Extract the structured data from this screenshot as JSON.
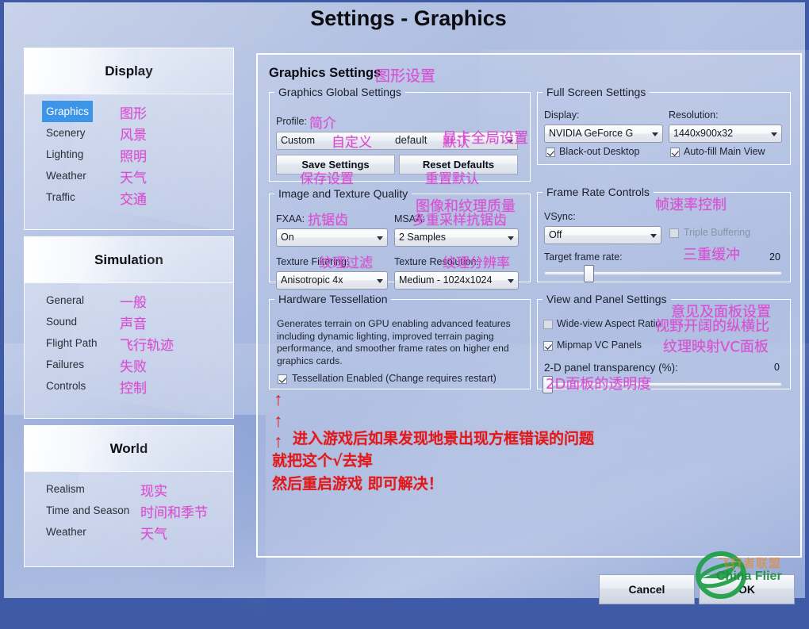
{
  "window": {
    "title": "Settings - Graphics"
  },
  "sidebar": {
    "groups": [
      {
        "header": "Display",
        "items": [
          {
            "label": "Graphics",
            "cn": "图形",
            "selected": true
          },
          {
            "label": "Scenery",
            "cn": "风景",
            "selected": false
          },
          {
            "label": "Lighting",
            "cn": "照明",
            "selected": false
          },
          {
            "label": "Weather",
            "cn": "天气",
            "selected": false
          },
          {
            "label": "Traffic",
            "cn": "交通",
            "selected": false
          }
        ]
      },
      {
        "header": "Simulation",
        "items": [
          {
            "label": "General",
            "cn": "一般",
            "selected": false
          },
          {
            "label": "Sound",
            "cn": "声音",
            "selected": false
          },
          {
            "label": "Flight Path",
            "cn": "飞行轨迹",
            "selected": false
          },
          {
            "label": "Failures",
            "cn": "失败",
            "selected": false
          },
          {
            "label": "Controls",
            "cn": "控制",
            "selected": false
          }
        ]
      },
      {
        "header": "World",
        "items": [
          {
            "label": "Realism",
            "cn": "现实",
            "selected": false
          },
          {
            "label": "Time and Season",
            "cn": "时间和季节",
            "selected": false
          },
          {
            "label": "Weather",
            "cn": "天气",
            "selected": false
          }
        ]
      }
    ]
  },
  "main": {
    "title": "Graphics Settings",
    "title_cn": "图形设置",
    "global": {
      "legend": "Graphics Global Settings",
      "legend_cn": "显卡全局设置",
      "profile_label": "Profile:",
      "profile_label_cn": "简介",
      "profile_value": "Custom",
      "profile_value_cn": "自定义",
      "profile_value2": "default",
      "profile_value2_cn": "默认",
      "save_label": "Save Settings",
      "save_cn": "保存设置",
      "reset_label": "Reset Defaults",
      "reset_cn": "重置默认"
    },
    "quality": {
      "legend": "Image and Texture Quality",
      "legend_cn": "图像和纹理质量",
      "fxaa_label": "FXAA:",
      "fxaa_cn": "抗锯齿",
      "fxaa_value": "On",
      "msaa_label": "MSAA:",
      "msaa_cn": "多重采样抗锯齿",
      "msaa_value": "2 Samples",
      "filtering_label": "Texture Filtering:",
      "filtering_cn": "纹理过滤",
      "filtering_value": "Anisotropic 4x",
      "resolution_label": "Texture Resolution:",
      "resolution_cn": "纹理分辨率",
      "resolution_value": "Medium - 1024x1024"
    },
    "tessellation": {
      "legend": "Hardware Tessellation",
      "description": "Generates terrain on GPU enabling advanced features including dynamic lighting, improved terrain paging performance, and smoother frame rates on higher end graphics cards.",
      "checkbox_label": "Tessellation Enabled (Change requires restart)",
      "checked": true
    },
    "fullscreen": {
      "legend": "Full Screen Settings",
      "display_label": "Display:",
      "display_value": "NVIDIA GeForce G",
      "resolution_label": "Resolution:",
      "resolution_value": "1440x900x32",
      "blackout_label": "Black-out Desktop",
      "blackout_checked": true,
      "autofill_label": "Auto-fill Main View",
      "autofill_checked": true
    },
    "framerate": {
      "legend": "Frame Rate Controls",
      "legend_cn": "帧速率控制",
      "vsync_label": "VSync:",
      "vsync_value": "Off",
      "triple_label": "Triple Buffering",
      "triple_cn": "三重缓冲",
      "triple_checked": false,
      "target_label": "Target frame rate:",
      "target_value": "20"
    },
    "viewpanel": {
      "legend": "View and Panel Settings",
      "legend_cn": "意见及面板设置",
      "wideview_label": "Wide-view Aspect Ratio",
      "wideview_cn": "视野开阔的纵横比",
      "wideview_checked": false,
      "mipmap_label": "Mipmap VC Panels",
      "mipmap_cn": "纹理映射VC面板",
      "mipmap_checked": true,
      "transparency_label": "2-D panel transparency (%):",
      "transparency_cn": "2D面板的透明度",
      "transparency_value": "0"
    }
  },
  "annotation": {
    "arrow": "↑",
    "line1": "进入游戏后如果发现地景出现方框错误的问题",
    "line2": "就把这个√去掉",
    "line3": "然后重启游戏 即可解决！"
  },
  "footer": {
    "cancel_label": "Cancel",
    "ok_label": "OK"
  },
  "watermark": {
    "cn": "飞行者联盟",
    "en": "China Flier"
  },
  "colors": {
    "accent": "#3d95e8",
    "annotation_pink": "#d94fd1",
    "annotation_red": "#e2191b",
    "frame_blue": "#3f5aa6"
  }
}
